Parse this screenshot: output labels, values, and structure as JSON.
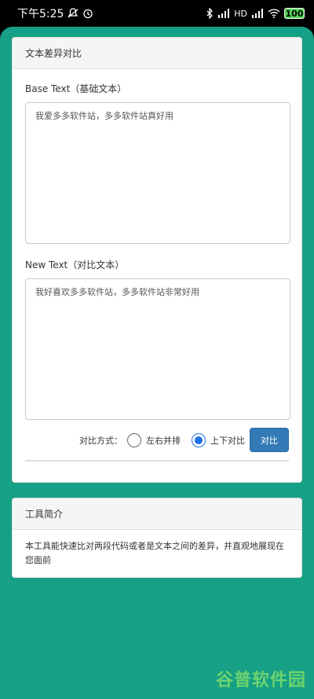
{
  "status_bar": {
    "time": "下午5:25",
    "battery": "100",
    "network_label": "HD"
  },
  "diff_panel": {
    "title": "文本差异对比",
    "base_label": "Base Text（基础文本）",
    "base_value": "我爱多多软件站，多多软件站真好用",
    "new_label": "New Text（对比文本）",
    "new_value": "我好喜欢多多软件站，多多软件站非常好用",
    "mode_label": "对比方式：",
    "mode_options": [
      {
        "label": "左右并排",
        "selected": false
      },
      {
        "label": "上下对比",
        "selected": true
      }
    ],
    "compare_button": "对比"
  },
  "intro_panel": {
    "title": "工具简介",
    "description": "本工具能快速比对两段代码或者是文本之间的差异，并直观地展现在您面前"
  },
  "watermark": "谷普软件园",
  "colors": {
    "background": "#16a085",
    "primary_button": "#337ab7",
    "radio_checked": "#1a73e8"
  }
}
